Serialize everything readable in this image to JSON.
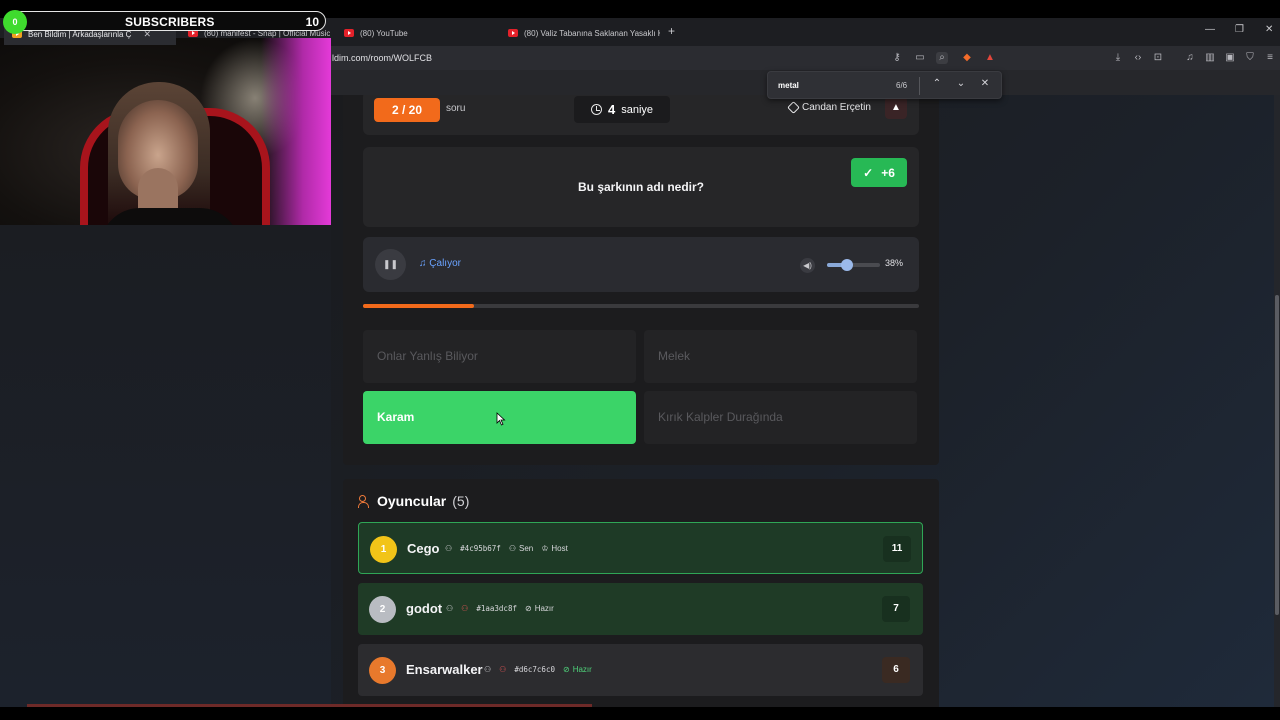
{
  "overlay": {
    "subs_dot": "0",
    "subs_label": "SUBSCRIBERS",
    "subs_count": "10"
  },
  "browser": {
    "tabs": [
      {
        "label": "Ben Bildim | Arkadaşlarınla Ç"
      },
      {
        "label": "(80) manifest - Snap | Official Music"
      },
      {
        "label": "(80) YouTube"
      },
      {
        "label": "(80) Valiz Tabanına Saklanan Yasaklı K"
      }
    ],
    "url": "ldim.com/room/WOLFCB",
    "find": {
      "query": "metal",
      "count": "6/6"
    }
  },
  "game": {
    "question_counter": "2 / 20",
    "question_suffix": "soru",
    "timer_value": "4",
    "timer_unit": "saniye",
    "artist": "Candan Erçetin",
    "warning_icon": "▲",
    "question": "Bu şarkının adı nedir?",
    "score_gain": "+6",
    "player_status": "Çalıyor",
    "volume_pct": "38%",
    "volume_value": 38,
    "progress_value": 0.2,
    "options": [
      {
        "label": "Onlar Yanlış Biliyor",
        "state": "dim"
      },
      {
        "label": "Melek",
        "state": "dim"
      },
      {
        "label": "Karam",
        "state": "correct"
      },
      {
        "label": "Kırık Kalpler Durağında",
        "state": "dim"
      }
    ]
  },
  "players": {
    "title": "Oyuncular",
    "count": "(5)",
    "rows": [
      {
        "rank": "1",
        "name": "Cego",
        "id": "#4c95b67f",
        "tag1": "Sen",
        "tag2": "Host",
        "score": "11",
        "rank_color": "#f2c418"
      },
      {
        "rank": "2",
        "name": "godot",
        "id": "#1aa3dc8f",
        "tag1": "Hazır",
        "score": "7",
        "rank_color": "#b9bcc2"
      },
      {
        "rank": "3",
        "name": "Ensarwalker",
        "id": "#d6c7c6c0",
        "tag1": "Hazır",
        "score": "6",
        "rank_color": "#e8792c"
      }
    ]
  }
}
